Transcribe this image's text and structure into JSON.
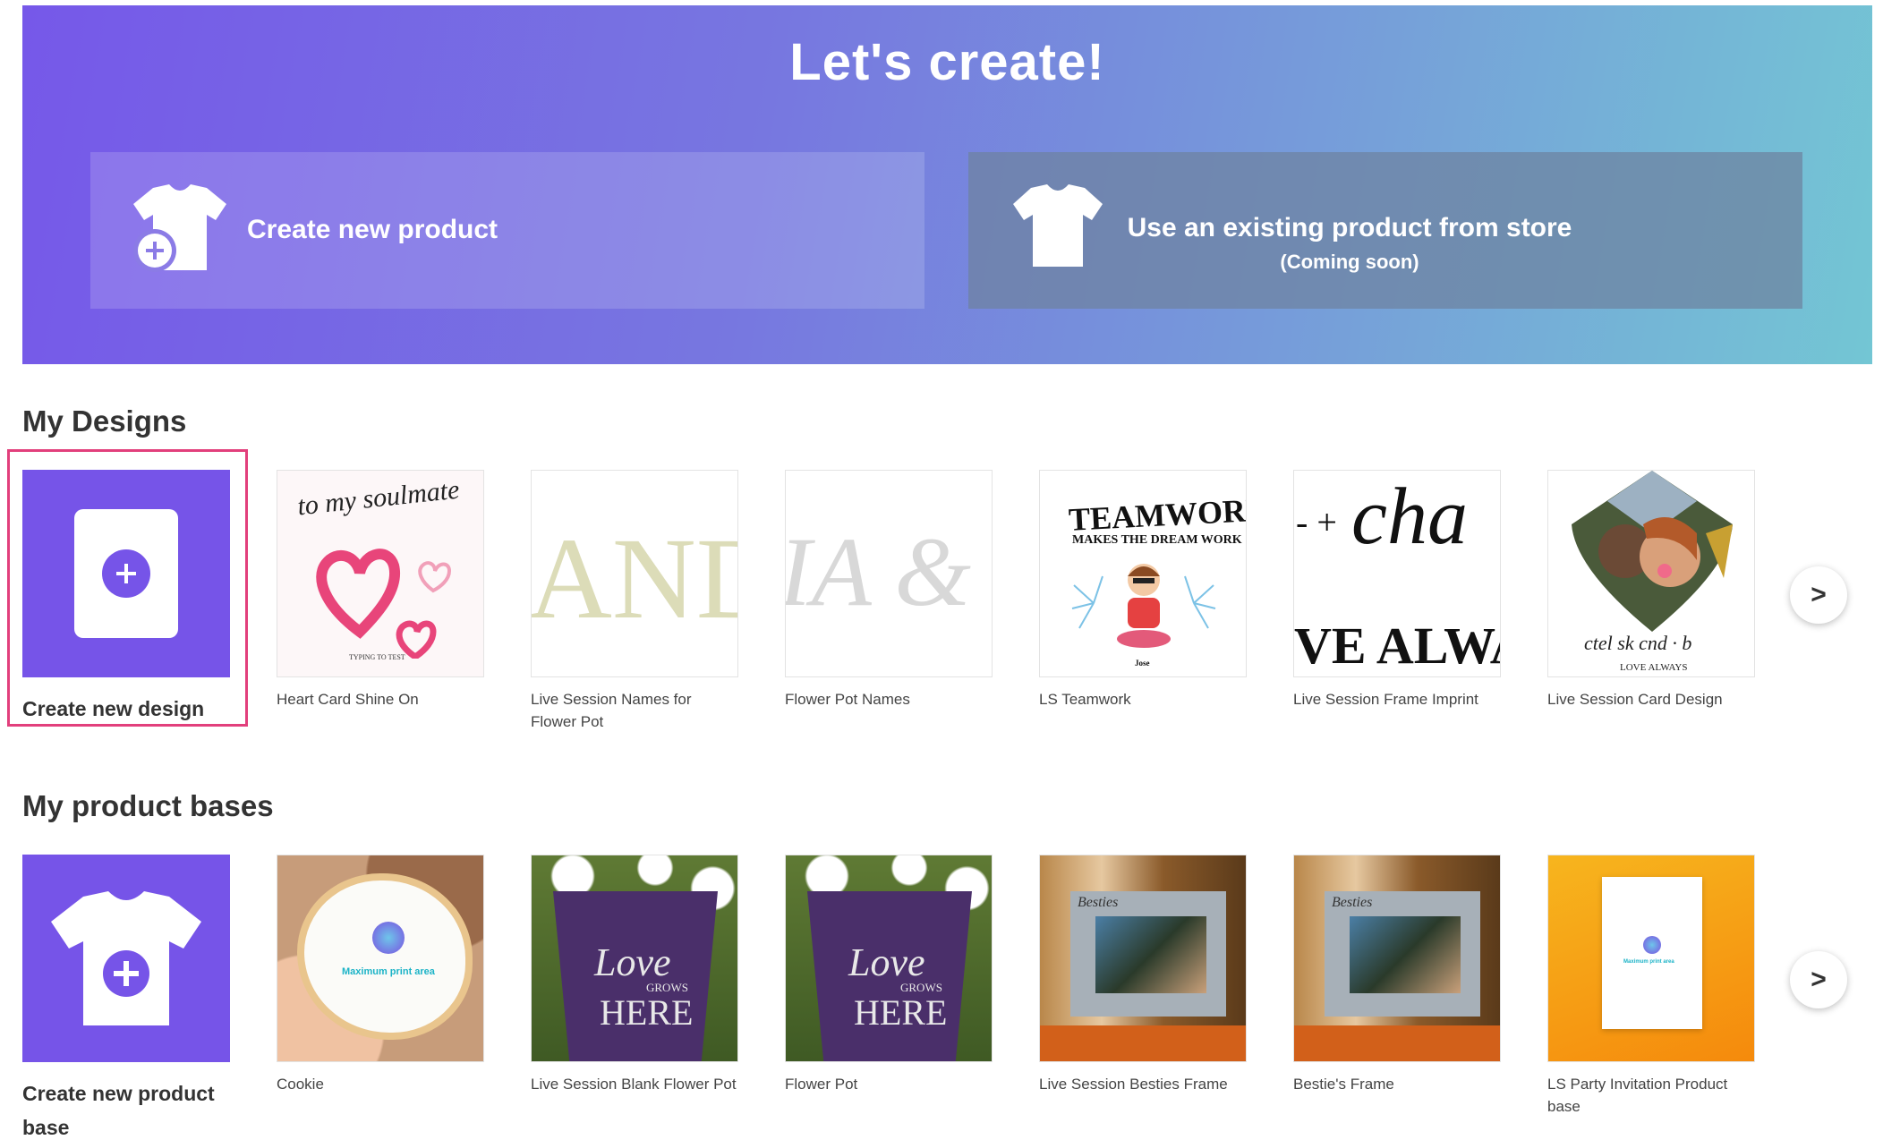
{
  "hero": {
    "title": "Let's create!",
    "create_product_label": "Create new product",
    "existing_product_label": "Use an existing product from store",
    "existing_product_sub": "(Coming soon)"
  },
  "designs": {
    "title": "My Designs",
    "create_label": "Create new design",
    "items": [
      {
        "label": "Heart Card Shine On",
        "thumb_text": "to my soulmate",
        "thumb_small": "TYPING TO TEST"
      },
      {
        "label": "Live Session Names for Flower Pot",
        "thumb_text": "AND"
      },
      {
        "label": "Flower Pot Names",
        "thumb_text": "IA &"
      },
      {
        "label": "LS Teamwork",
        "thumb_text": "TEAMWORK",
        "thumb_sub": "MAKES THE DREAM WORK",
        "thumb_name": "Jose"
      },
      {
        "label": "Live Session Frame Imprint",
        "thumb_text": "cha",
        "thumb_sub": "VE ALWA"
      },
      {
        "label": "Live Session Card Design",
        "thumb_sub": "LOVE ALWAYS"
      }
    ],
    "next_label": ">"
  },
  "bases": {
    "title": "My product bases",
    "create_label": "Create new product base",
    "items": [
      {
        "label": "Cookie",
        "thumb_text": "Maximum print area"
      },
      {
        "label": "Live Session Blank Flower Pot",
        "thumb_text": "Love",
        "thumb_sub": "GROWS",
        "thumb_big": "HERE"
      },
      {
        "label": "Flower Pot",
        "thumb_text": "Love",
        "thumb_sub": "GROWS",
        "thumb_big": "HERE"
      },
      {
        "label": "Live Session Besties Frame",
        "thumb_text": "Besties"
      },
      {
        "label": "Bestie's Frame",
        "thumb_text": "Besties"
      },
      {
        "label": "LS Party Invitation Product base",
        "thumb_text": "Maximum print area"
      }
    ],
    "next_label": ">"
  },
  "colors": {
    "accent": "#7654e8",
    "highlight": "#e23f7c"
  }
}
